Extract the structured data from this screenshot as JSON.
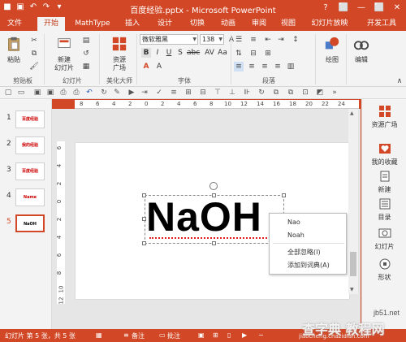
{
  "window": {
    "title": "百度经验.pptx - Microsoft PowerPoint",
    "controls": [
      "?",
      "⬜",
      "—",
      "⬜",
      "✕"
    ]
  },
  "tabs": [
    {
      "label": "文件",
      "active": false
    },
    {
      "label": "开始",
      "active": true
    },
    {
      "label": "MathType",
      "active": false
    },
    {
      "label": "插入",
      "active": false
    },
    {
      "label": "设计",
      "active": false
    },
    {
      "label": "切换",
      "active": false
    },
    {
      "label": "动画",
      "active": false
    },
    {
      "label": "审阅",
      "active": false
    },
    {
      "label": "视图",
      "active": false
    },
    {
      "label": "幻灯片放映",
      "active": false
    },
    {
      "label": "开发工具",
      "active": false
    }
  ],
  "ribbon": {
    "clipboard": {
      "paste": "粘贴",
      "group": "剪贴板"
    },
    "slides": {
      "new_slide_1": "新建",
      "new_slide_2": "幻灯片",
      "group": "幻灯片"
    },
    "beautify": {
      "resource_1": "资源",
      "resource_2": "广场",
      "group": "美化大师"
    },
    "font": {
      "family": "微软雅黑",
      "size": "138",
      "group": "字体"
    },
    "paragraph": {
      "group": "段落"
    },
    "drawing": {
      "label": "绘图"
    },
    "editing": {
      "label": "编辑"
    }
  },
  "ruler": {
    "h_ticks": [
      "8",
      "6",
      "4",
      "2",
      "0",
      "2",
      "4",
      "6",
      "8",
      "10",
      "12",
      "14",
      "16",
      "18",
      "20",
      "22",
      "24"
    ],
    "v_ticks": [
      "6",
      "4",
      "2",
      "0",
      "2",
      "4",
      "6",
      "8",
      "10",
      "12"
    ]
  },
  "thumbnails": [
    {
      "num": "1",
      "text": "百度经验"
    },
    {
      "num": "2",
      "text": "我的经验"
    },
    {
      "num": "3",
      "text": "百度经验"
    },
    {
      "num": "4",
      "text": "Name"
    },
    {
      "num": "5",
      "text": "NaOH"
    }
  ],
  "slide": {
    "text": "NaOH"
  },
  "context_menu": {
    "items": [
      "Nao",
      "Noah"
    ],
    "actions": [
      "全部忽略(I)",
      "添加到词典(A)"
    ]
  },
  "right_pane": [
    {
      "label": "资源广场",
      "icon": "grid-icon"
    },
    {
      "label": "我的收藏",
      "icon": "heart-icon"
    },
    {
      "label": "新建",
      "icon": "new-doc-icon"
    },
    {
      "label": "目录",
      "icon": "list-icon"
    },
    {
      "label": "幻灯片",
      "icon": "slides-icon"
    },
    {
      "label": "形状",
      "icon": "shape-icon"
    }
  ],
  "status": {
    "slide_info": "幻灯片 第 5 张，共 5 张",
    "notes": "备注",
    "comments": "批注"
  },
  "watermark": {
    "line1": "jb51.net",
    "line2": "查字典 教程网",
    "line3": "jiaocheng.chazidian.com"
  },
  "colors": {
    "accent": "#d24726",
    "ribbon_bg": "#f3f3f3",
    "spell_error": "#e02020"
  }
}
